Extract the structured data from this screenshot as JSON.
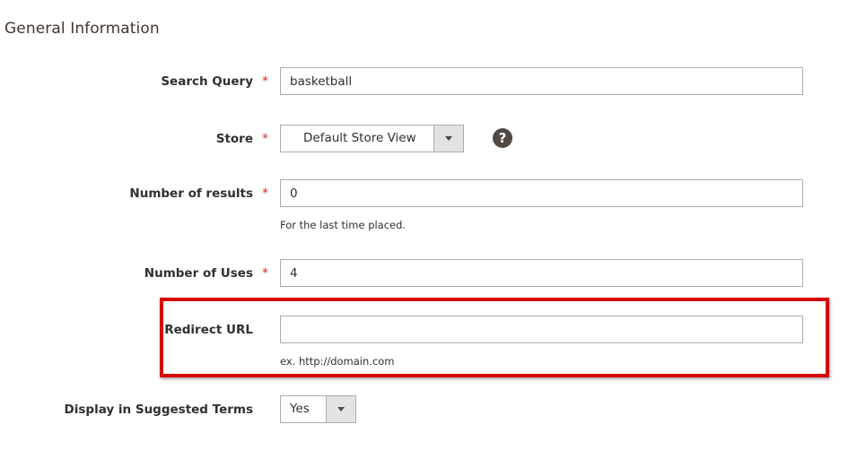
{
  "section": {
    "title": "General Information"
  },
  "fields": {
    "search_query": {
      "label": "Search Query",
      "required_mark": "*",
      "value": "basketball"
    },
    "store": {
      "label": "Store",
      "required_mark": "*",
      "selected": "Default Store View",
      "help_icon": "question-mark-icon",
      "help_glyph": "?"
    },
    "number_of_results": {
      "label": "Number of results",
      "required_mark": "*",
      "value": "0",
      "note": "For the last time placed."
    },
    "number_of_uses": {
      "label": "Number of Uses",
      "required_mark": "*",
      "value": "4"
    },
    "redirect_url": {
      "label": "Redirect URL",
      "value": "",
      "note": "ex. http://domain.com"
    },
    "display_in_suggested_terms": {
      "label": "Display in Suggested Terms",
      "selected": "Yes"
    }
  },
  "colors": {
    "required": "#e22626",
    "highlight": "#d60000",
    "arrow_bg": "#e3e3e3",
    "border": "#adadad",
    "help_bg": "#514943"
  }
}
